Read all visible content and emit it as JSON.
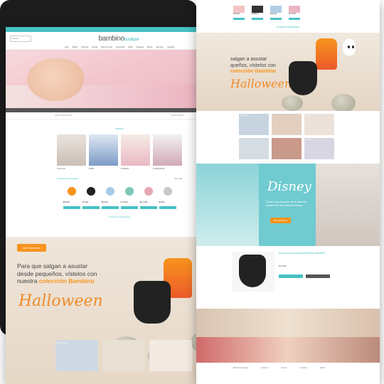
{
  "left_page": {
    "header": {
      "search_placeholder": "Buscar",
      "logo_main": "bambino",
      "logo_sub": "boutique",
      "cart_label": "Carrito"
    },
    "menu": [
      "Inicio",
      "Bebés",
      "Nuestros",
      "Ropita",
      "Para su Cuna",
      "Accesorios",
      "Baño",
      "Juguetes",
      "Mamá",
      "Servicios",
      "Contacto"
    ],
    "strip": [
      "Envío a todo el país",
      "Compra segura"
    ],
    "categories_title": "Nuevo",
    "categories": [
      {
        "caption": "TOALLAS"
      },
      {
        "caption": "ROPA"
      },
      {
        "caption": "PIJAMAS"
      },
      {
        "caption": "CONJUNTOS"
      }
    ],
    "products_title": "Productos Destacados",
    "products_more": "Ver más",
    "products": [
      {
        "price": "$18,900"
      },
      {
        "price": "$ 8,900"
      },
      {
        "price": "$19,900"
      },
      {
        "price": "$ 13,900"
      },
      {
        "price": "$8, 1,900"
      },
      {
        "price": "$3,000"
      }
    ],
    "featured_label": "Productos Destacados",
    "halloween": {
      "badge": "Ver Colección",
      "line1": "Para que salgan a asustar",
      "line2": "desde pequeños, vístelos con",
      "line3_prefix": "nuestra ",
      "line3_bold": "colección Bambino",
      "script": "Halloween"
    },
    "bottom_categories": [
      "Conjuntos",
      "",
      "Body",
      "Mantitas",
      "",
      "Gorros"
    ]
  },
  "right_page": {
    "products": [
      {
        "price": "$18,900"
      },
      {
        "price": "$ 8,900"
      },
      {
        "price": "$19,900"
      },
      {
        "price": "$ 13,900"
      }
    ],
    "featured_label": "Productos Destacados",
    "halloween": {
      "line1": "saigan a asustar",
      "line2": "queños, vístelos con",
      "line3": "colección Bambino",
      "script": "Halloween"
    },
    "cats": [
      "Conjuntos",
      "",
      "Body",
      "",
      "",
      "Gorros"
    ],
    "disney": {
      "logo": "Disney",
      "text": "Cuida a los pequeños de la casa con nuestro mix de productos Disney",
      "button": "Ver Colección"
    },
    "product_detail": {
      "title": "Body para los más pequeños Baby Halloween",
      "price": "$13,900",
      "add_button": "Agregar al carrito",
      "buy_button": "Comprar"
    },
    "footer": [
      "Bambino Boutique",
      "Nosotros",
      "Envíos",
      "Contacto",
      "Redes"
    ]
  },
  "colors": {
    "accent": "#46c1c4",
    "orange": "#f7941d",
    "frame": "#1c1c1c"
  }
}
